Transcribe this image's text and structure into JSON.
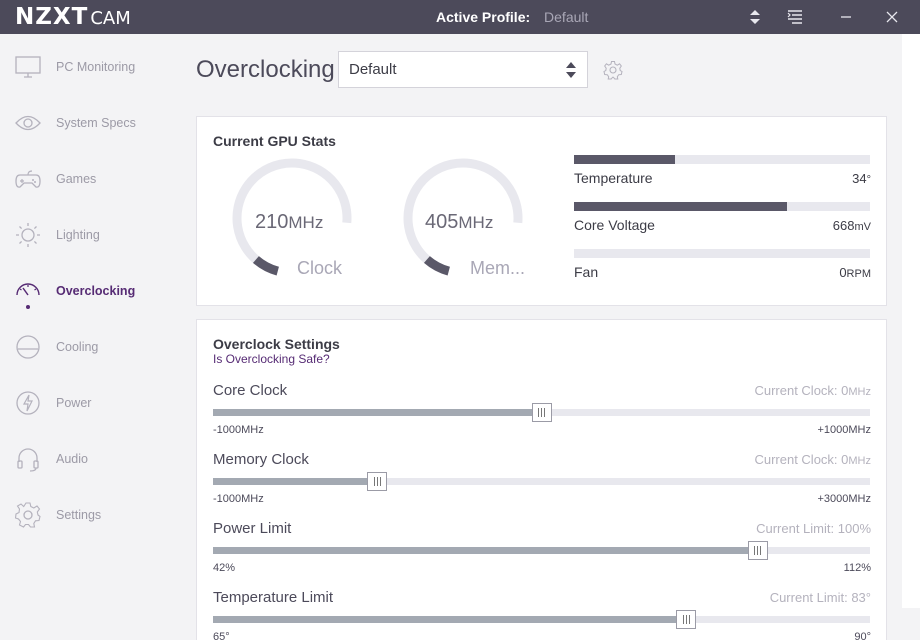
{
  "titlebar": {
    "logo_main": "NZXT",
    "logo_sub": "CAM",
    "profile_label": "Active Profile:",
    "profile_value": "Default"
  },
  "sidebar": {
    "items": [
      {
        "label": "PC Monitoring",
        "icon": "monitor-icon"
      },
      {
        "label": "System Specs",
        "icon": "eye-icon"
      },
      {
        "label": "Games",
        "icon": "gamepad-icon"
      },
      {
        "label": "Lighting",
        "icon": "sun-icon"
      },
      {
        "label": "Overclocking",
        "icon": "speedometer-icon"
      },
      {
        "label": "Cooling",
        "icon": "cooling-icon"
      },
      {
        "label": "Power",
        "icon": "power-bolt-icon"
      },
      {
        "label": "Audio",
        "icon": "headphones-icon"
      },
      {
        "label": "Settings",
        "icon": "gear-icon"
      }
    ],
    "active": "Overclocking"
  },
  "header": {
    "title": "Overclocking",
    "profile_select": "Default"
  },
  "gpu_stats": {
    "title": "Current GPU Stats",
    "gauges": [
      {
        "value": "210",
        "unit": "MHz",
        "label": "Clock",
        "fraction": 0.1
      },
      {
        "value": "405",
        "unit": "MHz",
        "label": "Mem...",
        "fraction": 0.1
      }
    ],
    "bars": [
      {
        "name": "Temperature",
        "value": "34",
        "unit": "°",
        "fraction": 0.34
      },
      {
        "name": "Core Voltage",
        "value": "668",
        "unit": "mV",
        "fraction": 0.72
      },
      {
        "name": "Fan",
        "value": "0",
        "unit": "RPM",
        "fraction": 0
      }
    ]
  },
  "oc_settings": {
    "title": "Overclock Settings",
    "safe_link": "Is Overclocking Safe?",
    "sliders": [
      {
        "name": "Core Clock",
        "current_label": "Current Clock: ",
        "current_value": "0",
        "current_unit": "MHz",
        "min": "-1000MHz",
        "max": "+1000MHz",
        "fraction": 0.5
      },
      {
        "name": "Memory Clock",
        "current_label": "Current Clock: ",
        "current_value": "0",
        "current_unit": "MHz",
        "min": "-1000MHz",
        "max": "+3000MHz",
        "fraction": 0.25
      },
      {
        "name": "Power Limit",
        "current_label": "Current Limit: ",
        "current_value": "100",
        "current_unit": "%",
        "min": "42%",
        "max": "112%",
        "fraction": 0.829
      },
      {
        "name": "Temperature Limit",
        "current_label": "Current Limit: ",
        "current_value": "83",
        "current_unit": "°",
        "min": "65°",
        "max": "90°",
        "fraction": 0.72
      }
    ]
  },
  "colors": {
    "titlebar": "#4c4a5a",
    "accent": "#562b74",
    "gauge_track": "#e8e8ee",
    "gauge_fill": "#5a5868"
  }
}
